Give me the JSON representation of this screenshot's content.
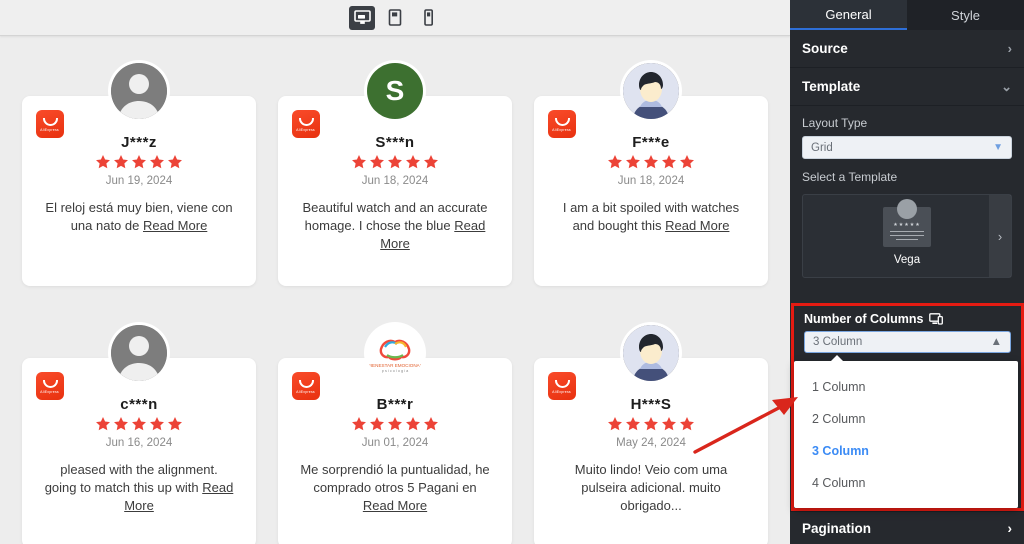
{
  "device_bar": {
    "devices": [
      {
        "name": "desktop-view",
        "icon": "desktop-icon",
        "active": true
      },
      {
        "name": "tablet-view",
        "icon": "tablet-icon",
        "active": false
      },
      {
        "name": "mobile-view",
        "icon": "mobile-icon",
        "active": false
      }
    ]
  },
  "reviews": [
    {
      "name": "J***z",
      "stars": 5,
      "date": "Jun 19, 2024",
      "text": "El reloj está muy bien, viene con una nato de ",
      "read_more": "Read More",
      "source_badge": "aliexpress-icon",
      "avatar_type": "silhouette",
      "avatar_letter": "",
      "avatar_color": "#7d7d7d"
    },
    {
      "name": "S***n",
      "stars": 5,
      "date": "Jun 18, 2024",
      "text": "Beautiful watch and an accurate homage. I chose the blue ",
      "read_more": "Read More",
      "source_badge": "aliexpress-icon",
      "avatar_type": "letter",
      "avatar_letter": "S",
      "avatar_color": "#3d7030"
    },
    {
      "name": "F***e",
      "stars": 5,
      "date": "Jun 18, 2024",
      "text": "I am a bit spoiled with watches and bought this ",
      "read_more": "Read More",
      "source_badge": "aliexpress-icon",
      "avatar_type": "person",
      "avatar_letter": "",
      "avatar_color": "#dfe3f0"
    },
    {
      "name": "c***n",
      "stars": 5,
      "date": "Jun 16, 2024",
      "text": "pleased with the alignment. going to match this up with ",
      "read_more": "Read More",
      "source_badge": "aliexpress-icon",
      "avatar_type": "silhouette",
      "avatar_letter": "",
      "avatar_color": "#7d7d7d"
    },
    {
      "name": "B***r",
      "stars": 5,
      "date": "Jun 01, 2024",
      "text": "Me sorprendió la puntualidad, he comprado otros 5 Pagani en ",
      "read_more": "Read More",
      "source_badge": "aliexpress-icon",
      "avatar_type": "brand",
      "avatar_letter": "",
      "avatar_color": "#ffffff"
    },
    {
      "name": "H***S",
      "stars": 5,
      "date": "May 24, 2024",
      "text": "Muito lindo! Veio com uma pulseira adicional. muito obrigado...",
      "read_more": "",
      "source_badge": "aliexpress-icon",
      "avatar_type": "person",
      "avatar_letter": "",
      "avatar_color": "#dfe3f0"
    }
  ],
  "panel": {
    "tabs": [
      {
        "label": "General",
        "active": true
      },
      {
        "label": "Style",
        "active": false
      }
    ],
    "source_label": "Source",
    "source_chevron": "chevron-right-icon",
    "template_label": "Template",
    "template_chevron": "chevron-down-icon",
    "layout_type_label": "Layout Type",
    "layout_type_value": "Grid",
    "select_template_label": "Select a Template",
    "template_name": "Vega",
    "template_next": "chevron-right-icon",
    "columns_label": "Number of Columns",
    "columns_responsive_icon": "responsive-monitor-icon",
    "columns_value": "3 Column",
    "columns_options": [
      {
        "label": "1 Column",
        "selected": false
      },
      {
        "label": "2 Column",
        "selected": false
      },
      {
        "label": "3 Column",
        "selected": true
      },
      {
        "label": "4 Column",
        "selected": false
      }
    ],
    "pagination_label": "Pagination",
    "pagination_chevron": "chevron-right-icon"
  },
  "annotations": {
    "highlight_color": "#e51b12",
    "arrow_color": "#d9261c",
    "accent_blue": "#3b8bf5",
    "star_color": "#ec4337"
  }
}
